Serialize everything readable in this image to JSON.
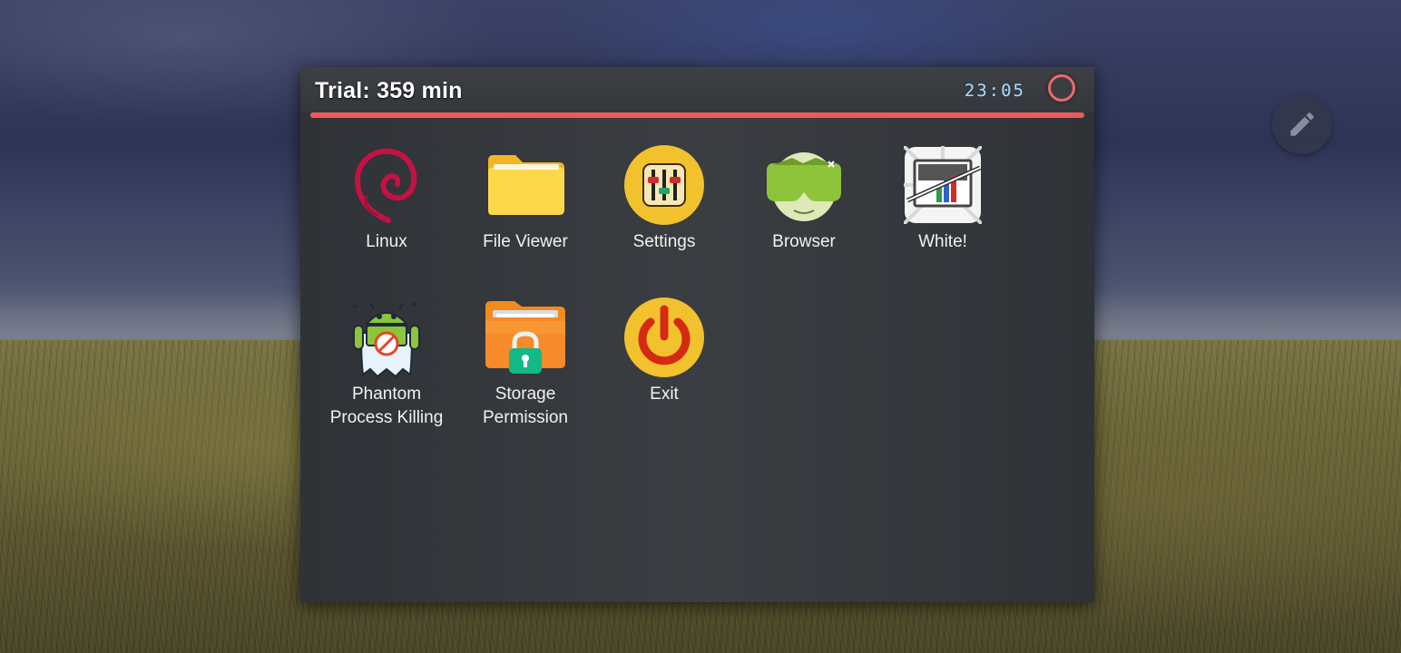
{
  "window": {
    "title": "Trial: 359 min",
    "clock": "23:05",
    "trial_progress": 1.0
  },
  "apps": [
    {
      "label": "Linux",
      "icon": "debian-swirl-icon"
    },
    {
      "label": "File Viewer",
      "icon": "folder-icon"
    },
    {
      "label": "Settings",
      "icon": "equalizer-settings-icon"
    },
    {
      "label": "Browser",
      "icon": "vr-goggles-browser-icon"
    },
    {
      "label": "White!",
      "icon": "white-chart-icon"
    },
    {
      "label": "Phantom\nProcess Killing",
      "label_line1": "Phantom",
      "label_line2": "Process Killing",
      "icon": "android-ghost-icon"
    },
    {
      "label": "Storage\nPermission",
      "label_line1": "Storage",
      "label_line2": "Permission",
      "icon": "locked-folder-icon"
    },
    {
      "label": "Exit",
      "icon": "power-icon"
    }
  ],
  "colors": {
    "accent": "#ee5a5a",
    "clock": "#a8dcff",
    "yellow": "#f2c12e"
  }
}
